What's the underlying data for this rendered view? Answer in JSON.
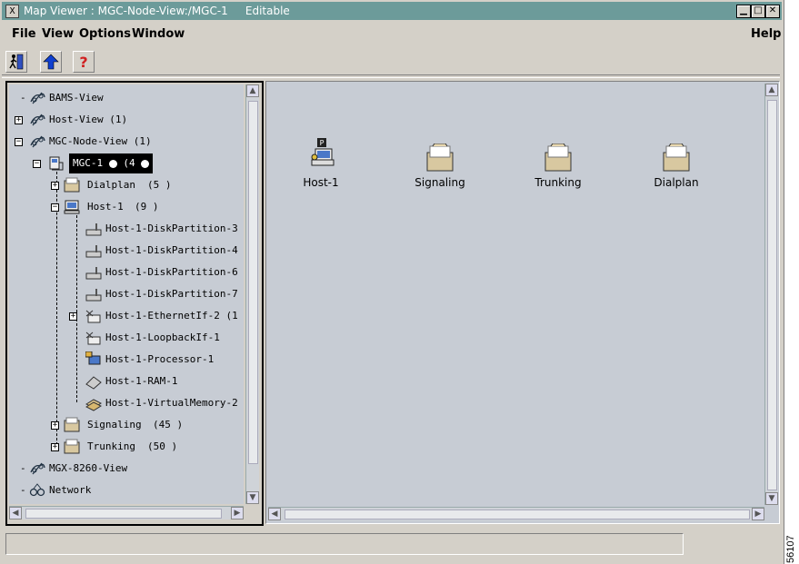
{
  "window": {
    "title": "Map Viewer : MGC-Node-View:/MGC-1",
    "mode": "Editable"
  },
  "menu": {
    "file": "File",
    "view": "View",
    "options": "Options",
    "window": "Window",
    "help": "Help"
  },
  "tree": {
    "bams": "BAMS-View",
    "host_view": "Host-View (1)",
    "mgc_node_view": "MGC-Node-View (1)",
    "mgc1": "MGC-1",
    "mgc1_count": "(4",
    "dialplan": "Dialplan",
    "dialplan_count": "(5   )",
    "host1": "Host-1",
    "host1_count": "(9   )",
    "children": [
      "Host-1-DiskPartition-3",
      "Host-1-DiskPartition-4",
      "Host-1-DiskPartition-6",
      "Host-1-DiskPartition-7",
      "Host-1-EthernetIf-2   (1",
      "Host-1-LoopbackIf-1",
      "Host-1-Processor-1",
      "Host-1-RAM-1",
      "Host-1-VirtualMemory-2"
    ],
    "signaling": "Signaling",
    "signaling_count": "(45   )",
    "trunking": "Trunking",
    "trunking_count": "(50   )",
    "mgx": "MGX-8260-View",
    "network": "Network"
  },
  "map": {
    "items": [
      "Host-1",
      "Signaling",
      "Trunking",
      "Dialplan"
    ],
    "badge": "P"
  },
  "figure_number": "56107",
  "colors": {
    "titlebar": "#6c9b9a",
    "panel": "#c7ccd4"
  }
}
